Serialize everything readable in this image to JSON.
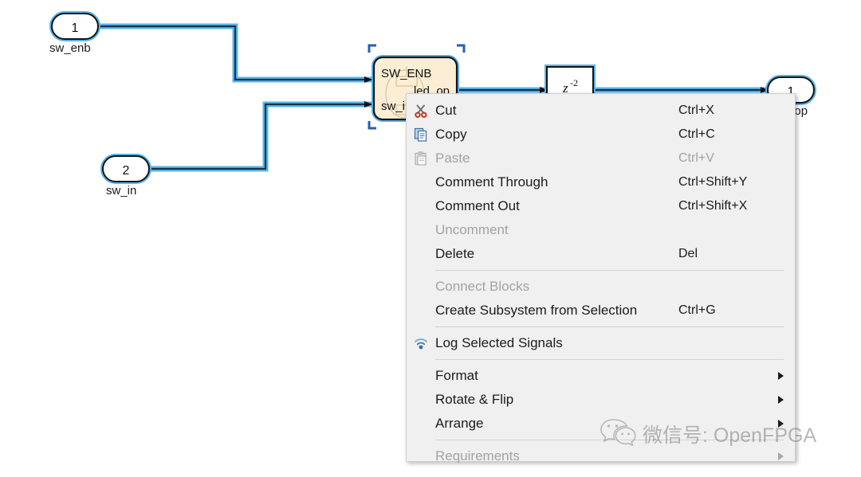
{
  "canvas": {
    "background_color": "#ffffff",
    "selection_color": "#4aa8e8",
    "line_color": "#12314a",
    "block_fill": "#fbeed4",
    "block_border": "#1b1b1b",
    "blocks": [
      {
        "id": "inport-1",
        "type": "inport",
        "number": "1",
        "label": "sw_enb",
        "selected": true
      },
      {
        "id": "inport-2",
        "type": "inport",
        "number": "2",
        "label": "sw_in",
        "selected": true
      },
      {
        "id": "subsystem-sw-enb",
        "type": "subsystem",
        "title": "SW_ENB",
        "input_ports": [
          "SW_ENB",
          "sw_in"
        ],
        "output_ports": [
          "led_op"
        ],
        "selected": true
      },
      {
        "id": "delay-z2",
        "type": "delay",
        "expression": "z",
        "exponent": "-2",
        "selected": true
      },
      {
        "id": "outport-1",
        "type": "outport",
        "number": "1",
        "label": "led_op",
        "selected": true
      }
    ]
  },
  "context_menu": {
    "sections": [
      {
        "items": [
          {
            "label": "Cut",
            "accel": "Ctrl+X",
            "icon": "scissors-icon",
            "disabled": false,
            "submenu": false
          },
          {
            "label": "Copy",
            "accel": "Ctrl+C",
            "icon": "copy-icon",
            "disabled": false,
            "submenu": false
          },
          {
            "label": "Paste",
            "accel": "Ctrl+V",
            "icon": "paste-icon",
            "disabled": true,
            "submenu": false
          },
          {
            "label": "Comment Through",
            "accel": "Ctrl+Shift+Y",
            "icon": "",
            "disabled": false,
            "submenu": false
          },
          {
            "label": "Comment Out",
            "accel": "Ctrl+Shift+X",
            "icon": "",
            "disabled": false,
            "submenu": false
          },
          {
            "label": "Uncomment",
            "accel": "",
            "icon": "",
            "disabled": true,
            "submenu": false
          },
          {
            "label": "Delete",
            "accel": "Del",
            "icon": "",
            "disabled": false,
            "submenu": false
          }
        ]
      },
      {
        "items": [
          {
            "label": "Connect Blocks",
            "accel": "",
            "icon": "",
            "disabled": true,
            "submenu": false
          },
          {
            "label": "Create Subsystem from Selection",
            "accel": "Ctrl+G",
            "icon": "",
            "disabled": false,
            "submenu": false
          }
        ]
      },
      {
        "items": [
          {
            "label": "Log Selected Signals",
            "accel": "",
            "icon": "signal-icon",
            "disabled": false,
            "submenu": false
          }
        ]
      },
      {
        "items": [
          {
            "label": "Format",
            "accel": "",
            "icon": "",
            "disabled": false,
            "submenu": true
          },
          {
            "label": "Rotate & Flip",
            "accel": "",
            "icon": "",
            "disabled": false,
            "submenu": true
          },
          {
            "label": "Arrange",
            "accel": "",
            "icon": "",
            "disabled": false,
            "submenu": true
          }
        ]
      },
      {
        "items": [
          {
            "label": "Requirements",
            "accel": "",
            "icon": "",
            "disabled": true,
            "submenu": true
          }
        ]
      }
    ]
  },
  "watermark": {
    "text": "微信号: OpenFPGA",
    "icon": "wechat-icon"
  }
}
